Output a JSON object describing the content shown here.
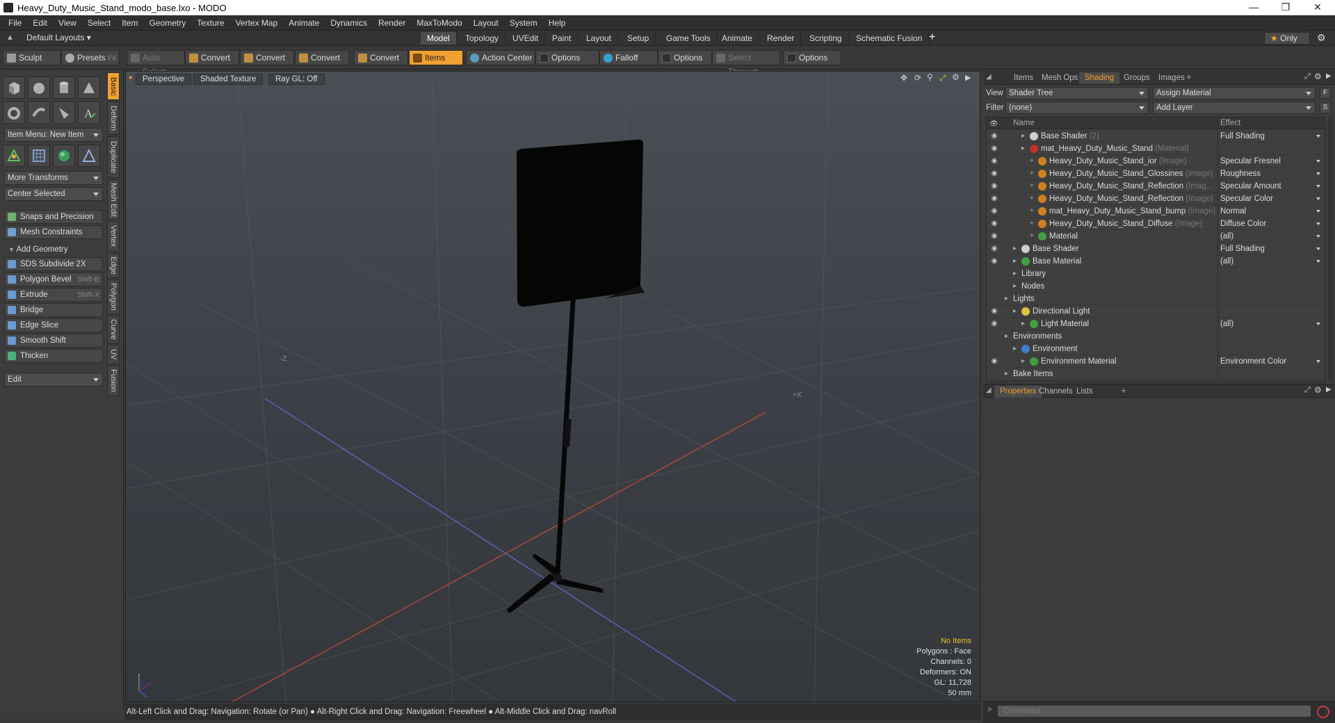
{
  "window": {
    "title": "Heavy_Duty_Music_Stand_modo_base.lxo - MODO"
  },
  "menu": [
    "File",
    "Edit",
    "View",
    "Select",
    "Item",
    "Geometry",
    "Texture",
    "Vertex Map",
    "Animate",
    "Dynamics",
    "Render",
    "MaxToModo",
    "Layout",
    "System",
    "Help"
  ],
  "layout": {
    "default_layouts": "Default Layouts",
    "tabs": [
      "Model",
      "Topology",
      "UVEdit",
      "Paint",
      "Layout",
      "Setup",
      "Game Tools",
      "Animate",
      "Render",
      "Scripting",
      "Schematic Fusion"
    ],
    "active_tab": "Model",
    "only_label": "Only"
  },
  "toolbar": {
    "sculpt": "Sculpt",
    "presets": "Presets",
    "presets_key": "F6",
    "auto_select": "Auto Select",
    "convert1": "Convert",
    "convert2": "Convert",
    "convert3": "Convert",
    "convert4": "Convert",
    "items": "Items",
    "action_center": "Action Center",
    "options1": "Options",
    "falloff": "Falloff",
    "options2": "Options",
    "select_through": "Select Through",
    "options3": "Options"
  },
  "left": {
    "vtabs": [
      "Basic",
      "Deform",
      "Duplicate",
      "Mesh Edit",
      "Vertex",
      "Edge",
      "Polygon",
      "Curve",
      "UV",
      "Fusion"
    ],
    "item_menu": "Item Menu: New Item",
    "more_transforms": "More Transforms",
    "center_selected": "Center Selected",
    "snaps": "Snaps and Precision",
    "mesh_constraints": "Mesh Constraints",
    "add_geometry": "Add Geometry",
    "tools": [
      {
        "label": "SDS Subdivide 2X",
        "key": ""
      },
      {
        "label": "Polygon Bevel",
        "key": "Shift-B"
      },
      {
        "label": "Extrude",
        "key": "Shift-X"
      },
      {
        "label": "Bridge",
        "key": ""
      },
      {
        "label": "Edge Slice",
        "key": ""
      },
      {
        "label": "Smooth Shift",
        "key": ""
      },
      {
        "label": "Thicken",
        "key": ""
      }
    ],
    "edit": "Edit"
  },
  "viewport": {
    "perspective": "Perspective",
    "shaded": "Shaded Texture",
    "raygl": "Ray GL: Off",
    "info": {
      "no_items": "No Items",
      "polygons": "Polygons : Face",
      "channels": "Channels: 0",
      "deformers": "Deformers: ON",
      "gl": "GL: 11,728",
      "scale": "50 mm"
    },
    "axis_x": "+X",
    "axis_z": "-Z"
  },
  "status": "Alt-Left Click and Drag: Navigation: Rotate (or Pan) ● Alt-Right Click and Drag: Navigation: Freewheel ● Alt-Middle Click and Drag: navRoll",
  "right": {
    "tabs": [
      "Items",
      "Mesh Ops",
      "Shading",
      "Groups",
      "Images"
    ],
    "active_tab": "Shading",
    "view_label": "View",
    "view_value": "Shader Tree",
    "assign_material": "Assign Material",
    "filter_label": "Filter",
    "filter_value": "(none)",
    "add_layer": "Add Layer",
    "col_name": "Name",
    "col_effect": "Effect",
    "rows": [
      {
        "name": "Base Shader",
        "type": "(2)",
        "effect": "Full Shading",
        "eye": true,
        "indent": 2,
        "color": "#cfcfcf"
      },
      {
        "name": "mat_Heavy_Duty_Music_Stand",
        "type": "(Material)",
        "effect": "",
        "eye": true,
        "indent": 2,
        "color": "#c03030"
      },
      {
        "name": "Heavy_Duty_Music_Stand_ior",
        "type": "(Image)",
        "effect": "Specular Fresnel",
        "eye": true,
        "indent": 3,
        "color": "#d08020"
      },
      {
        "name": "Heavy_Duty_Music_Stand_Glossines",
        "type": "(Image)",
        "effect": "Roughness",
        "eye": true,
        "indent": 3,
        "color": "#d08020"
      },
      {
        "name": "Heavy_Duty_Music_Stand_Reflection",
        "type": "(Imag...",
        "effect": "Specular Amount",
        "eye": true,
        "indent": 3,
        "color": "#d08020"
      },
      {
        "name": "Heavy_Duty_Music_Stand_Reflection",
        "type": "(Image)",
        "effect": "Specular Color",
        "eye": true,
        "indent": 3,
        "color": "#d08020"
      },
      {
        "name": "mat_Heavy_Duty_Music_Stand_bump",
        "type": "(Image)",
        "effect": "Normal",
        "eye": true,
        "indent": 3,
        "color": "#d08020"
      },
      {
        "name": "Heavy_Duty_Music_Stand_Diffuse",
        "type": "(Image)",
        "effect": "Diffuse Color",
        "eye": true,
        "indent": 3,
        "color": "#d08020"
      },
      {
        "name": "Material",
        "type": "",
        "effect": "(all)",
        "eye": true,
        "indent": 3,
        "color": "#40a040"
      },
      {
        "name": "Base Shader",
        "type": "",
        "effect": "Full Shading",
        "eye": true,
        "indent": 1,
        "color": "#cfcfcf"
      },
      {
        "name": "Base Material",
        "type": "",
        "effect": "(all)",
        "eye": true,
        "indent": 1,
        "color": "#40a040"
      },
      {
        "name": "Library",
        "type": "",
        "effect": "",
        "eye": false,
        "indent": 1,
        "color": ""
      },
      {
        "name": "Nodes",
        "type": "",
        "effect": "",
        "eye": false,
        "indent": 1,
        "color": ""
      },
      {
        "name": "Lights",
        "type": "",
        "effect": "",
        "eye": false,
        "indent": 0,
        "color": ""
      },
      {
        "name": "Directional Light",
        "type": "",
        "effect": "",
        "eye": true,
        "indent": 1,
        "color": "#e0c040"
      },
      {
        "name": "Light Material",
        "type": "",
        "effect": "(all)",
        "eye": true,
        "indent": 2,
        "color": "#40a040"
      },
      {
        "name": "Environments",
        "type": "",
        "effect": "",
        "eye": false,
        "indent": 0,
        "color": ""
      },
      {
        "name": "Environment",
        "type": "",
        "effect": "",
        "eye": false,
        "indent": 1,
        "color": "#4080d0"
      },
      {
        "name": "Environment Material",
        "type": "",
        "effect": "Environment Color",
        "eye": true,
        "indent": 2,
        "color": "#40a040"
      },
      {
        "name": "Bake Items",
        "type": "",
        "effect": "",
        "eye": false,
        "indent": 0,
        "color": ""
      }
    ],
    "props_tabs": [
      "Properties",
      "Channels",
      "Lists"
    ],
    "command_placeholder": "Command"
  }
}
